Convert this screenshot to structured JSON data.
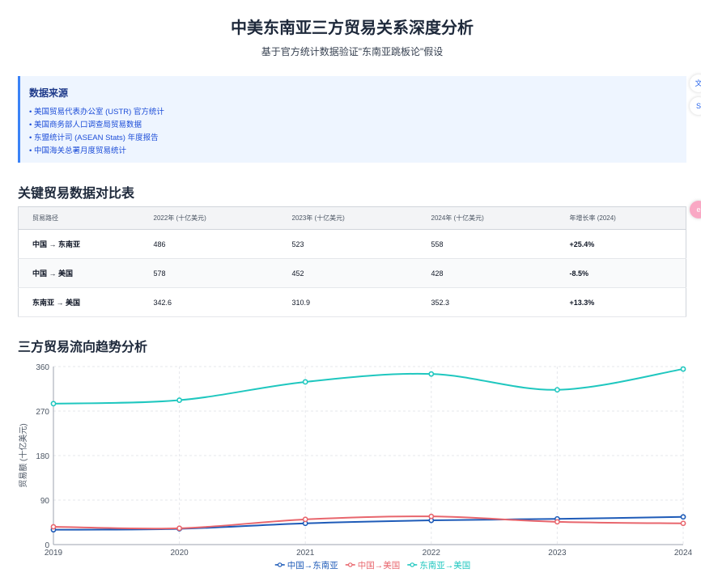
{
  "header": {
    "title": "中美东南亚三方贸易关系深度分析",
    "subtitle": "基于官方统计数据验证\"东南亚跳板论\"假设"
  },
  "sources": {
    "title": "数据来源",
    "items": [
      "美国贸易代表办公室 (USTR) 官方统计",
      "美国商务部人口调查局贸易数据",
      "东盟统计司 (ASEAN Stats) 年度报告",
      "中国海关总署月度贸易统计"
    ]
  },
  "table_section": {
    "title": "关键贸易数据对比表",
    "headers": [
      "贸易路径",
      "2022年 (十亿美元)",
      "2023年 (十亿美元)",
      "2024年 (十亿美元)",
      "年增长率 (2024)"
    ],
    "rows": [
      {
        "route": "中国 → 东南亚",
        "v2022": "486",
        "v2023": "523",
        "v2024": "558",
        "growth": "+25.4%",
        "trend": "up"
      },
      {
        "route": "中国 → 美国",
        "v2022": "578",
        "v2023": "452",
        "v2024": "428",
        "growth": "-8.5%",
        "trend": "down"
      },
      {
        "route": "东南亚 → 美国",
        "v2022": "342.6",
        "v2023": "310.9",
        "v2024": "352.3",
        "growth": "+13.3%",
        "trend": "up"
      }
    ]
  },
  "chart_section": {
    "title": "三方贸易流向趋势分析"
  },
  "side_widgets": {
    "translate_label": "文",
    "assistant_label": "S",
    "pink_label": "e"
  },
  "chart_data": {
    "type": "line",
    "x": [
      "2019",
      "2020",
      "2021",
      "2022",
      "2023",
      "2024"
    ],
    "ylabel": "贸易额 (十亿美元)",
    "xlabel": "",
    "ylim": [
      0,
      360
    ],
    "yticks": [
      0,
      90,
      180,
      270,
      360
    ],
    "grid": true,
    "legend_position": "bottom",
    "series": [
      {
        "name": "中国→东南亚",
        "color": "#1e5bb8",
        "values": [
          30,
          32,
          43,
          49,
          52,
          56
        ]
      },
      {
        "name": "中国→美国",
        "color": "#e8666d",
        "values": [
          36,
          33,
          51,
          57,
          46,
          43
        ]
      },
      {
        "name": "东南亚→美国",
        "color": "#1fc7bf",
        "values": [
          285,
          292,
          329,
          345,
          313,
          355
        ]
      }
    ]
  }
}
